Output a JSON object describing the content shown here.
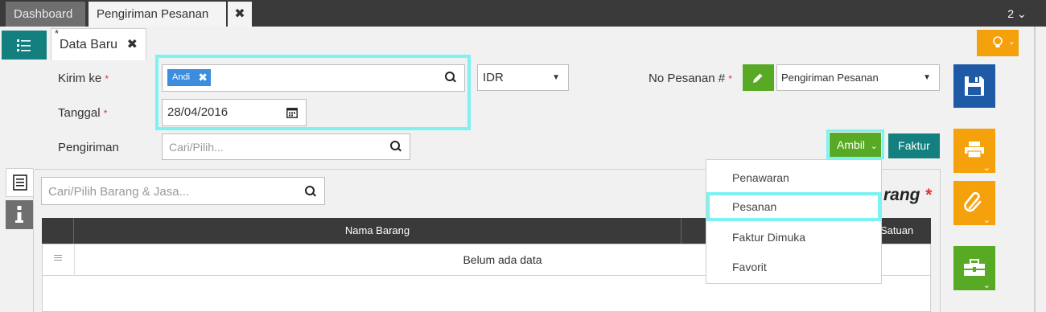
{
  "tabs": {
    "dashboard": "Dashboard",
    "active": "Pengiriman Pesanan",
    "close": "✖",
    "counter": "2 ⌄"
  },
  "subtab": {
    "modified_marker": "*",
    "label": "Data Baru",
    "close": "✖"
  },
  "form": {
    "kirim_ke_label": "Kirim ke",
    "tanggal_label": "Tanggal",
    "pengiriman_label": "Pengiriman",
    "required_mark": "*",
    "kirim_ke_chip": "Andi",
    "chip_close": "✖",
    "tanggal_value": "28/04/2016",
    "pengiriman_placeholder": "Cari/Pilih...",
    "currency": "IDR",
    "no_pesanan_label": "No Pesanan #",
    "no_pesanan_type": "Pengiriman Pesanan"
  },
  "actions": {
    "ambil": "Ambil",
    "faktur": "Faktur"
  },
  "dropdown": {
    "items": [
      "Penawaran",
      "Pesanan",
      "Faktur Dimuka",
      "Favorit"
    ],
    "highlighted": "Pesanan"
  },
  "items": {
    "search_placeholder": "Cari/Pilih Barang & Jasa...",
    "section_title_partial": "rang",
    "columns": [
      "Nama Barang",
      "Satuan"
    ],
    "empty_text": "Belum ada data"
  },
  "colors": {
    "primary_teal": "#147f7f",
    "green": "#58a923",
    "orange": "#f4a10c",
    "blue": "#1f5aa6",
    "highlight": "#7cf2f2"
  }
}
